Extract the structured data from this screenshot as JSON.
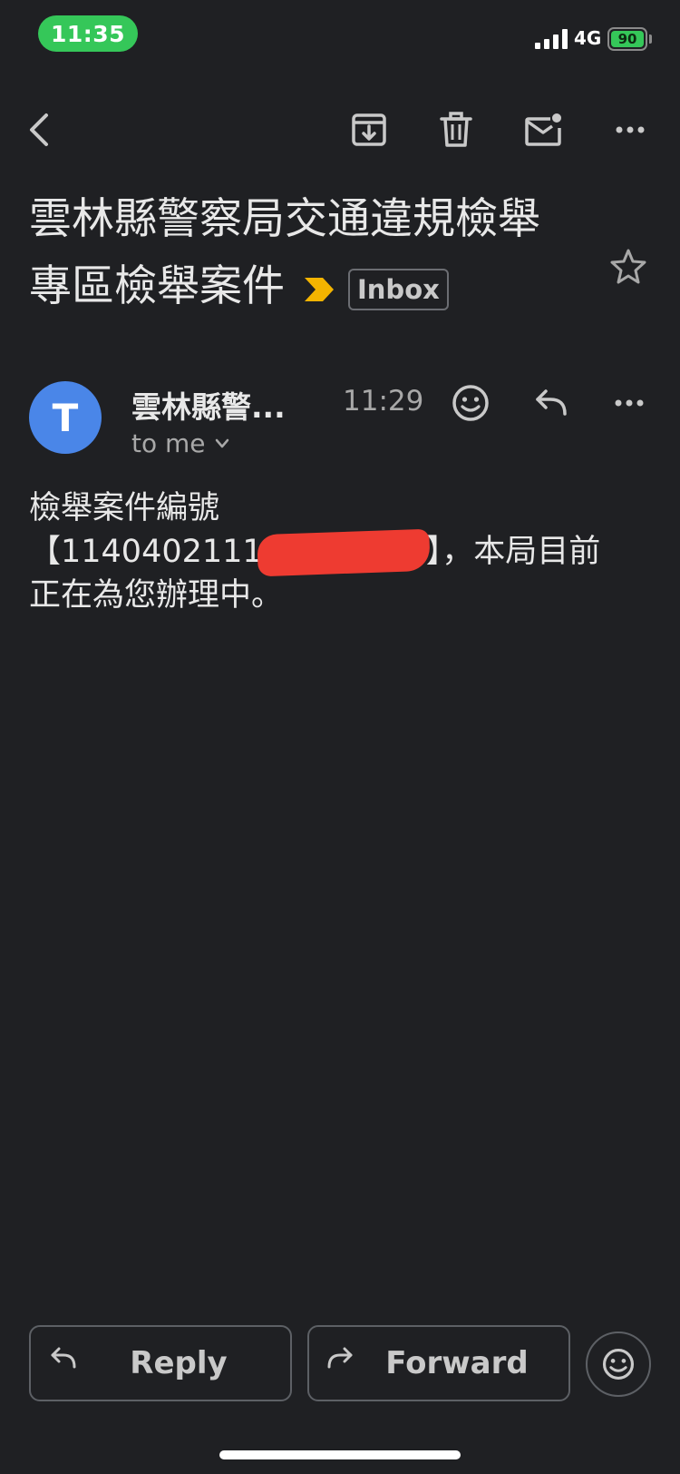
{
  "status_bar": {
    "time": "11:35",
    "network": "4G",
    "battery": "90"
  },
  "toolbar": {
    "icons": [
      "back-icon",
      "archive-icon",
      "delete-icon",
      "mark-unread-icon",
      "more-icon"
    ]
  },
  "email": {
    "subject": "雲林縣警察局交通違規檢舉專區檢舉案件",
    "label": "Inbox",
    "starred": false,
    "sender_initial": "T",
    "sender": "雲林縣警...",
    "time": "11:29",
    "recipient": "to me",
    "body_line1": "檢舉案件編號",
    "body_line2_start": "【1140402111",
    "body_line2_end": "】，本局目前",
    "body_line3": "正在為您辦理中。"
  },
  "actions": {
    "reply_label": "Reply",
    "forward_label": "Forward"
  },
  "colors": {
    "background": "#1f2023",
    "accent_green": "#35c759",
    "avatar_blue": "#4a86e8",
    "importance_yellow": "#f4b400",
    "redaction_red": "#ee3b31"
  }
}
